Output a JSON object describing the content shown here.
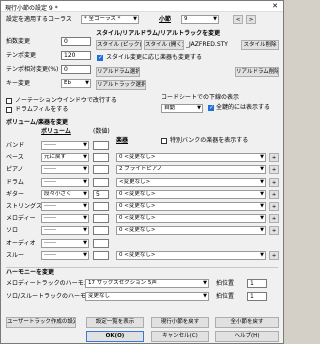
{
  "window": {
    "title": "現行小節の設定 9 *",
    "close": "✕"
  },
  "top": {
    "apply_chorus_label": "設定を適用するコーラス",
    "chorus_value": "* 全コーラス *",
    "measure_label": "小節",
    "measure_value": "9",
    "prev": "<",
    "next": ">"
  },
  "left_fields": [
    {
      "label": "拍数変更",
      "value": "0"
    },
    {
      "label": "テンポ変更",
      "value": "120"
    },
    {
      "label": "テンポ相対変更(%)",
      "value": "0"
    },
    {
      "label": "キー変更",
      "value": "Eb"
    }
  ],
  "style_section": {
    "heading": "スタイル/リアルドラム/リアルトラックを変更",
    "style_pick": "スタイル (ピック)",
    "style_open": "スタイル (開く)",
    "style_file": "_JAZFRED.STY",
    "style_delete": "スタイル削除",
    "auto_change_label": "スタイル変更に応じ楽器も変更する",
    "realdrum_select": "リアルドラム選択",
    "realdrum_delete": "リアルドラム削除",
    "realtrack_select": "リアルトラック選択"
  },
  "checks": {
    "notation_wrap": "ノーテーションウインドウで改行する",
    "drum_fill": "ドラムフィルをする"
  },
  "chord_sheet": {
    "label": "コードシートでの下線の表示",
    "value": "自動",
    "always_show": "全鍵的には表示する"
  },
  "volume_section": {
    "heading": "ボリューム/楽器を変更",
    "col_volume": "ボリューム",
    "col_default": "(数値)",
    "col_instrument": "楽器",
    "special_bank": "特別バンクの楽器を表示する",
    "rows": [
      {
        "part": "バンド",
        "volume": "------",
        "num": "",
        "instrument": ""
      },
      {
        "part": "ベース",
        "volume": "元に戻す",
        "num": "",
        "instrument": "0 <変更なし>"
      },
      {
        "part": "ピアノ",
        "volume": "------",
        "num": "",
        "instrument": "2 ブライトピアノ"
      },
      {
        "part": "ドラム",
        "volume": "------",
        "num": "",
        "instrument": "<変更なし>"
      },
      {
        "part": "ギター",
        "volume": "段々小さく",
        "num": "5",
        "instrument": "0 <変更なし>"
      },
      {
        "part": "ストリングス",
        "volume": "------",
        "num": "",
        "instrument": "0 <変更なし>"
      },
      {
        "part": "メロディー",
        "volume": "------",
        "num": "",
        "instrument": "0 <変更なし>"
      },
      {
        "part": "ソロ",
        "volume": "------",
        "num": "",
        "instrument": "0 <変更なし>"
      },
      {
        "part": "オーディオ",
        "volume": "------",
        "num": "",
        "instrument": ""
      },
      {
        "part": "スルー",
        "volume": "------",
        "num": "",
        "instrument": "0 <変更なし>"
      }
    ]
  },
  "harmony_section": {
    "heading": "ハーモニーを変更",
    "melody_label": "メロディートラックのハーモニー",
    "melody_value": "17 サックスセクション 5声",
    "solo_label": "ソロ/スルートラックのハーモニー",
    "solo_value": "変更なし",
    "degree_label": "拍位置",
    "melody_degree": "1",
    "solo_degree": "1"
  },
  "bottom": {
    "user_default": "ユーザートラック作成の設定",
    "show_settings": "設定一覧を表示",
    "reset_current": "現行小節を戻す",
    "reset_all": "全小節を戻す",
    "ok": "OK(O)",
    "cancel": "キャンセル(C)",
    "help": "ヘルプ(H)"
  }
}
